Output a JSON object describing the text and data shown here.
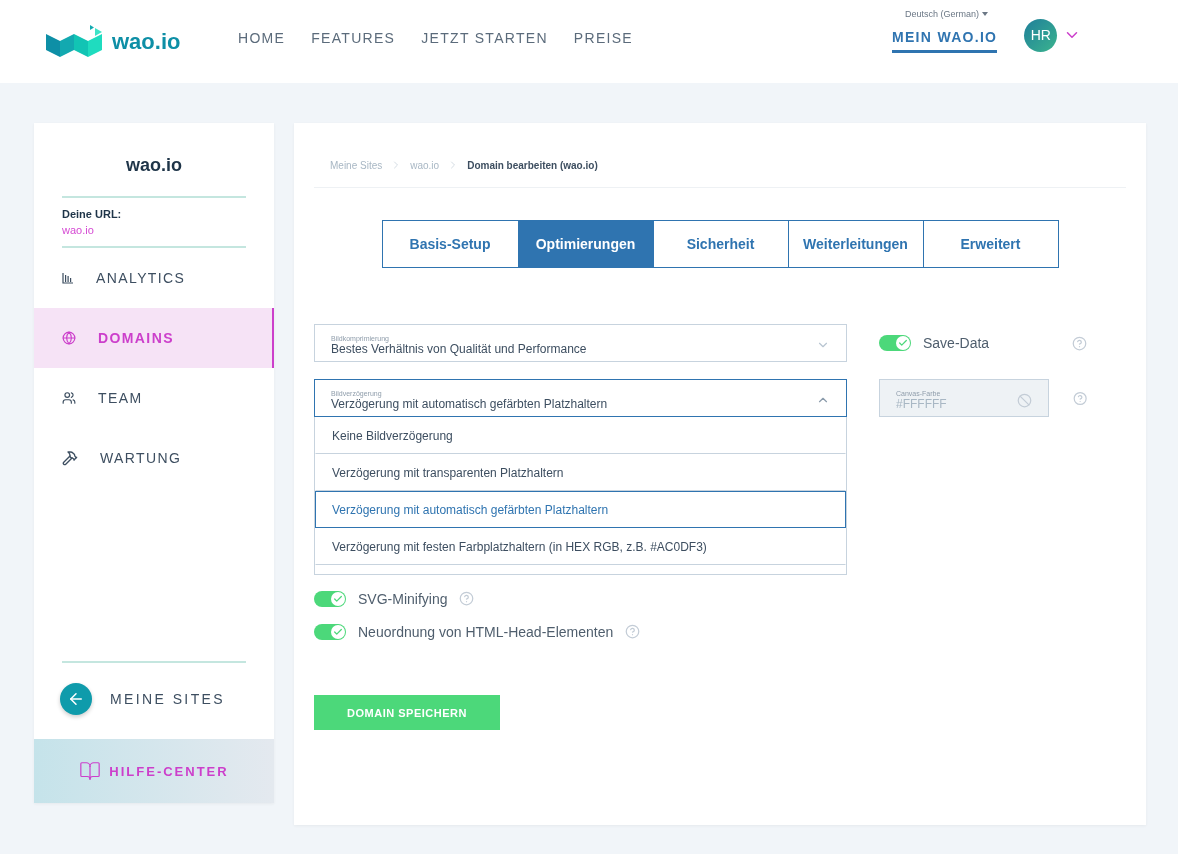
{
  "header": {
    "logo": "wao.io",
    "nav": [
      {
        "label": "HOME",
        "selected": false
      },
      {
        "label": "FEATURES",
        "selected": false
      },
      {
        "label": "JETZT STARTEN",
        "selected": false
      },
      {
        "label": "PREISE",
        "selected": false
      }
    ],
    "language": "Deutsch (German)",
    "account": {
      "label": "MEIN WAO.IO",
      "selected": true
    },
    "avatar": "HR"
  },
  "sidebar": {
    "title": "wao.io",
    "url_label": "Deine URL:",
    "url": "wao.io",
    "items": [
      {
        "label": "ANALYTICS",
        "kind": "chart",
        "selected": false
      },
      {
        "label": "DOMAINS",
        "kind": "globe",
        "selected": true
      },
      {
        "label": "TEAM",
        "kind": "team",
        "selected": false
      },
      {
        "label": "WARTUNG",
        "kind": "tools",
        "selected": false
      }
    ],
    "back": "MEINE SITES",
    "help": "HILFE-CENTER"
  },
  "breadcrumb": [
    "Meine Sites",
    "wao.io",
    "Domain bearbeiten (wao.io)"
  ],
  "tabs": [
    {
      "label": "Basis-Setup",
      "selected": false
    },
    {
      "label": "Optimierungen",
      "selected": true
    },
    {
      "label": "Sicherheit",
      "selected": false
    },
    {
      "label": "Weiterleitungen",
      "selected": false
    },
    {
      "label": "Erweitert",
      "selected": false
    }
  ],
  "image_compression": {
    "label": "Bildkomprimierung",
    "value": "Bestes Verhältnis von Qualität und Performance",
    "expanded": false
  },
  "lazy_loading": {
    "label": "Bildverzögerung",
    "value": "Verzögerung mit automatisch gefärbten Platzhaltern",
    "expanded": true,
    "options": [
      {
        "label": "Keine Bildverzögerung",
        "selected": false
      },
      {
        "label": "Verzögerung mit transparenten Platzhaltern",
        "selected": false
      },
      {
        "label": "Verzögerung mit automatisch gefärbten Platzhaltern",
        "selected": true
      },
      {
        "label": "Verzögerung mit festen Farbplatzhaltern (in HEX RGB, z.B. #AC0DF3)",
        "selected": false
      }
    ]
  },
  "save_data": {
    "label": "Save-Data",
    "on": true
  },
  "canvas_color": {
    "label": "Canvas-Farbe",
    "value": "#FFFFFF",
    "disabled": true
  },
  "toggles": [
    {
      "label": "SVG-Minifying",
      "on": true
    },
    {
      "label": "Neuordnung von HTML-Head-Elementen",
      "on": true
    }
  ],
  "save_button": "DOMAIN SPEICHERN"
}
